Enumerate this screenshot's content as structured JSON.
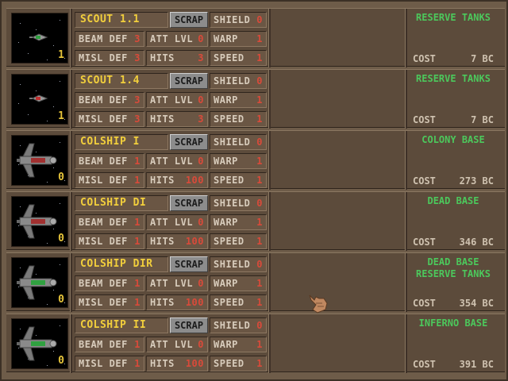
{
  "ui": {
    "scrap_label": "SCRAP",
    "labels": {
      "beam_def": "BEAM DEF",
      "misl_def": "MISL DEF",
      "att_lvl": "ATT LVL",
      "hits": "HITS",
      "shield": "SHIELD",
      "warp": "WARP",
      "speed": "SPEED",
      "cost": "COST"
    }
  },
  "colors": {
    "name_text": "#f2cf3c",
    "value_text": "#d94a3a",
    "special_text": "#4cc85c",
    "scrap_button": "#8c8c8c"
  },
  "ships": [
    {
      "name": "SCOUT 1.1",
      "count": "1",
      "beam_def": "3",
      "misl_def": "3",
      "att_lvl": "0",
      "hits": "3",
      "shield": "0",
      "warp": "1",
      "speed": "1",
      "specials": [
        "RESERVE TANKS"
      ],
      "cost": "7 BC",
      "icon": "scout-ship-icon"
    },
    {
      "name": "SCOUT 1.4",
      "count": "1",
      "beam_def": "3",
      "misl_def": "3",
      "att_lvl": "0",
      "hits": "3",
      "shield": "0",
      "warp": "1",
      "speed": "1",
      "specials": [
        "RESERVE TANKS"
      ],
      "cost": "7 BC",
      "icon": "scout-ship-icon"
    },
    {
      "name": "COLSHIP I",
      "count": "0",
      "beam_def": "1",
      "misl_def": "1",
      "att_lvl": "0",
      "hits": "100",
      "shield": "0",
      "warp": "1",
      "speed": "1",
      "specials": [
        "COLONY BASE"
      ],
      "cost": "273 BC",
      "icon": "colony-ship-icon"
    },
    {
      "name": "COLSHIP DI",
      "count": "0",
      "beam_def": "1",
      "misl_def": "1",
      "att_lvl": "0",
      "hits": "100",
      "shield": "0",
      "warp": "1",
      "speed": "1",
      "specials": [
        "DEAD BASE"
      ],
      "cost": "346 BC",
      "icon": "colony-ship-icon"
    },
    {
      "name": "COLSHIP DIR",
      "count": "0",
      "beam_def": "1",
      "misl_def": "1",
      "att_lvl": "0",
      "hits": "100",
      "shield": "0",
      "warp": "1",
      "speed": "1",
      "specials": [
        "DEAD BASE",
        "RESERVE TANKS"
      ],
      "cost": "354 BC",
      "icon": "colony-ship-icon"
    },
    {
      "name": "COLSHIP II",
      "count": "0",
      "beam_def": "1",
      "misl_def": "1",
      "att_lvl": "0",
      "hits": "100",
      "shield": "0",
      "warp": "1",
      "speed": "1",
      "specials": [
        "INFERNO BASE"
      ],
      "cost": "391 BC",
      "icon": "colony-ship-icon"
    }
  ]
}
